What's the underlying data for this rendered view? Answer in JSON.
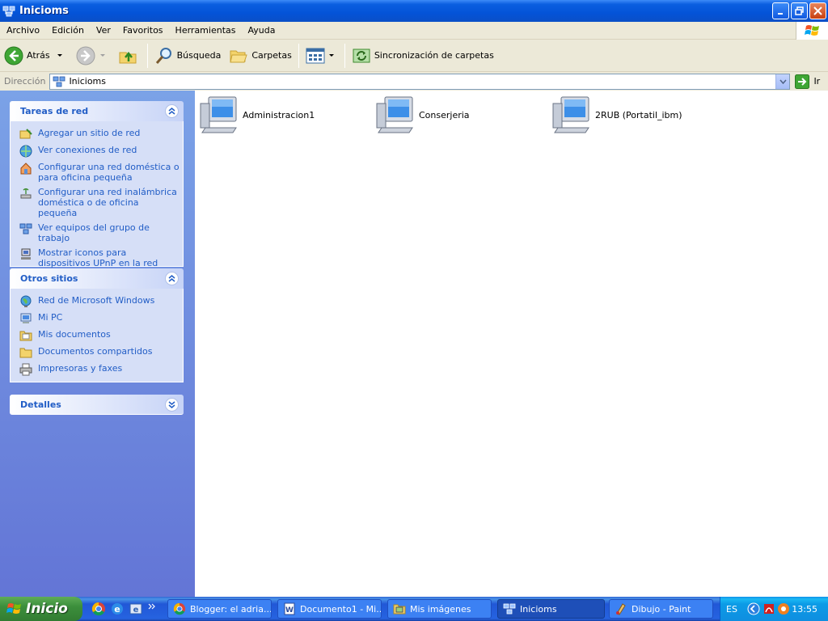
{
  "window": {
    "title": "Inicioms"
  },
  "menu": [
    "Archivo",
    "Edición",
    "Ver",
    "Favoritos",
    "Herramientas",
    "Ayuda"
  ],
  "toolbar": {
    "back_label": "Atrás",
    "search_label": "Búsqueda",
    "folders_label": "Carpetas",
    "sync_label": "Sincronización de carpetas"
  },
  "address": {
    "label": "Dirección",
    "value": "Inicioms",
    "go_label": "Ir"
  },
  "panels": {
    "network_tasks": {
      "title": "Tareas de red",
      "items": [
        "Agregar un sitio de red",
        "Ver conexiones de red",
        "Configurar una red doméstica o para oficina pequeña",
        "Configurar una red inalámbrica doméstica o de oficina pequeña",
        "Ver equipos del grupo de trabajo",
        "Mostrar iconos para dispositivos UPnP en la red"
      ]
    },
    "other_places": {
      "title": "Otros sitios",
      "items": [
        "Red de Microsoft Windows",
        "Mi PC",
        "Mis documentos",
        "Documentos compartidos",
        "Impresoras y faxes"
      ]
    },
    "details": {
      "title": "Detalles"
    }
  },
  "computers": [
    "Administracion1",
    "Conserjeria",
    "2RUB (Portatil_ibm)"
  ],
  "taskbar": {
    "start_label": "Inicio",
    "tasks": [
      "Blogger: el adria...",
      "Documento1 - Mi...",
      "Mis imágenes",
      "Inicioms",
      "Dibujo - Paint"
    ],
    "language": "ES",
    "clock": "13:55"
  },
  "colors": {
    "title_bar": "#0453d8",
    "task_pane": "#7ba2e7",
    "link_text": "#215dc6",
    "start_button": "#3c8f3c"
  }
}
